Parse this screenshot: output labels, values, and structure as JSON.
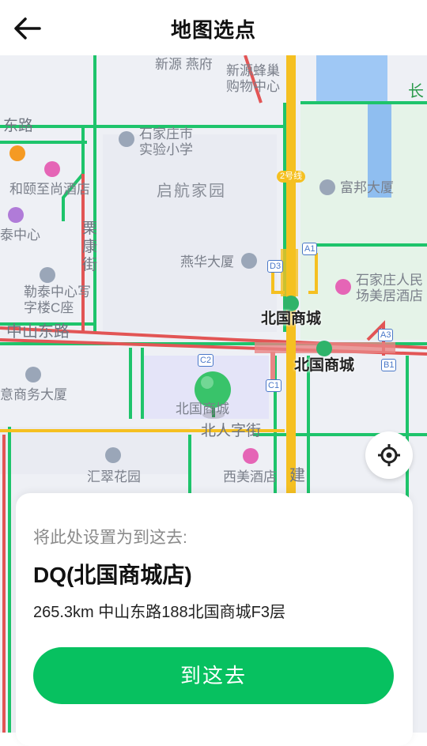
{
  "header": {
    "title": "地图选点"
  },
  "map": {
    "labels": {
      "xinyuan_yanyuan": "新源 燕府",
      "xinyuan_fengchao": "新源蜂巢",
      "gouwu_zhongxin": "购物中心",
      "zhongshan_east_top": "东路",
      "sjz_school_1": "石家庄市",
      "sjz_school_2": "实验小学",
      "hotel_heyi": "和颐至尚酒店",
      "qihang": "启航家园",
      "fubang": "富邦大厦",
      "taizhongxin": "泰中心",
      "lisu_1": "栗",
      "lisu_2": "康",
      "lisu_3": "街",
      "yanhua": "燕华大厦",
      "letai_1": "勒泰中心写",
      "letai_2": "字楼C座",
      "renmin_1": "石家庄人民",
      "renmin_2": "场美居酒店",
      "zhongshan": "中山东路",
      "beiguo_1": "北国商城",
      "beiguo_2": "北国商城",
      "beiguo_3": "北国商城",
      "yide": "意商务大厦",
      "beirenzi": "北人字街",
      "huifeng": "汇翠花园",
      "ximei": "西美酒店",
      "jian": "建",
      "chang": "长",
      "metro_2": "2号线",
      "exit_a1": "A1",
      "exit_d3": "D3",
      "exit_c2": "C2",
      "exit_c1": "C1",
      "exit_a3": "A3",
      "exit_b1": "B1"
    }
  },
  "card": {
    "hint": "将此处设置为到这去:",
    "name": "DQ(北国商城店)",
    "address": "265.3km 中山东路188北国商城F3层",
    "go_label": "到这去"
  },
  "colors": {
    "accent": "#07c160",
    "road_green": "#1ec46b",
    "road_red": "#e25555",
    "road_yellow": "#f5c021"
  }
}
